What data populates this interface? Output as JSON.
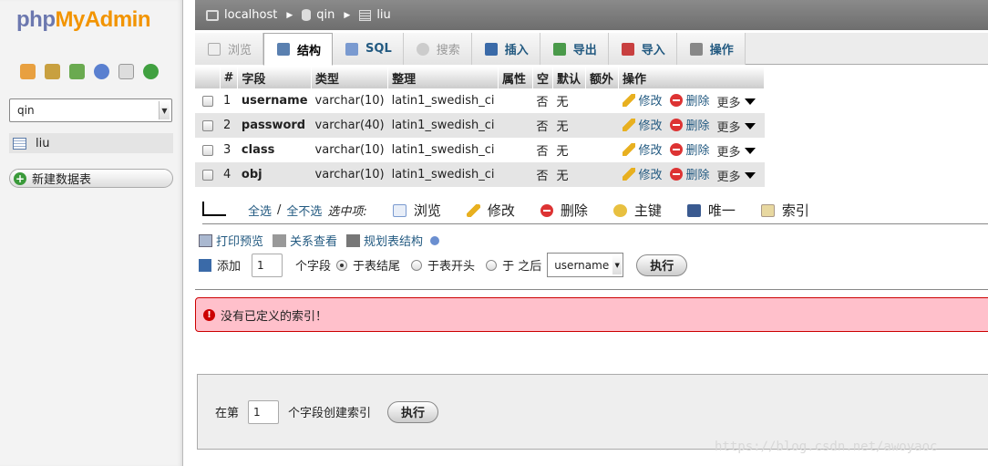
{
  "sidebar": {
    "logo": {
      "php": "php",
      "my": "MyAdmin"
    },
    "db_select_value": "qin",
    "table_item": "liu",
    "new_table_label": "新建数据表"
  },
  "breadcrumb": {
    "server": "localhost",
    "database": "qin",
    "table": "liu"
  },
  "tabs": [
    {
      "label": "浏览",
      "state": "disabled"
    },
    {
      "label": "结构",
      "state": "active"
    },
    {
      "label": "SQL",
      "state": "normal"
    },
    {
      "label": "搜索",
      "state": "disabled"
    },
    {
      "label": "插入",
      "state": "normal"
    },
    {
      "label": "导出",
      "state": "normal"
    },
    {
      "label": "导入",
      "state": "normal"
    },
    {
      "label": "操作",
      "state": "normal"
    }
  ],
  "structure": {
    "headers": [
      "#",
      "字段",
      "类型",
      "整理",
      "属性",
      "空",
      "默认",
      "额外",
      "操作"
    ],
    "rows": [
      {
        "num": "1",
        "field": "username",
        "type": "varchar(10)",
        "collation": "latin1_swedish_ci",
        "attr": "",
        "null": "否",
        "default": "无",
        "extra": ""
      },
      {
        "num": "2",
        "field": "password",
        "type": "varchar(40)",
        "collation": "latin1_swedish_ci",
        "attr": "",
        "null": "否",
        "default": "无",
        "extra": ""
      },
      {
        "num": "3",
        "field": "class",
        "type": "varchar(10)",
        "collation": "latin1_swedish_ci",
        "attr": "",
        "null": "否",
        "default": "无",
        "extra": ""
      },
      {
        "num": "4",
        "field": "obj",
        "type": "varchar(10)",
        "collation": "latin1_swedish_ci",
        "attr": "",
        "null": "否",
        "default": "无",
        "extra": ""
      }
    ],
    "actions": {
      "edit": "修改",
      "delete": "删除",
      "more": "更多"
    }
  },
  "with_selected": {
    "check_all": "全选",
    "separator": "/",
    "uncheck_all": "全不选",
    "label": "选中项:",
    "buttons": [
      "浏览",
      "修改",
      "删除",
      "主键",
      "唯一",
      "索引"
    ]
  },
  "links": {
    "print": "打印预览",
    "relation": "关系查看",
    "propose": "规划表结构"
  },
  "add_field": {
    "label": "添加",
    "count": "1",
    "unit": "个字段",
    "opt_end": "于表结尾",
    "opt_start": "于表开头",
    "opt_after": "于 之后",
    "after_column": "username",
    "go": "执行"
  },
  "error_message": "没有已定义的索引！",
  "index_create": {
    "prefix": "在第",
    "count": "1",
    "suffix": "个字段创建索引",
    "go": "执行"
  },
  "watermark": "https://blog.csdn.net/awoyaoc"
}
